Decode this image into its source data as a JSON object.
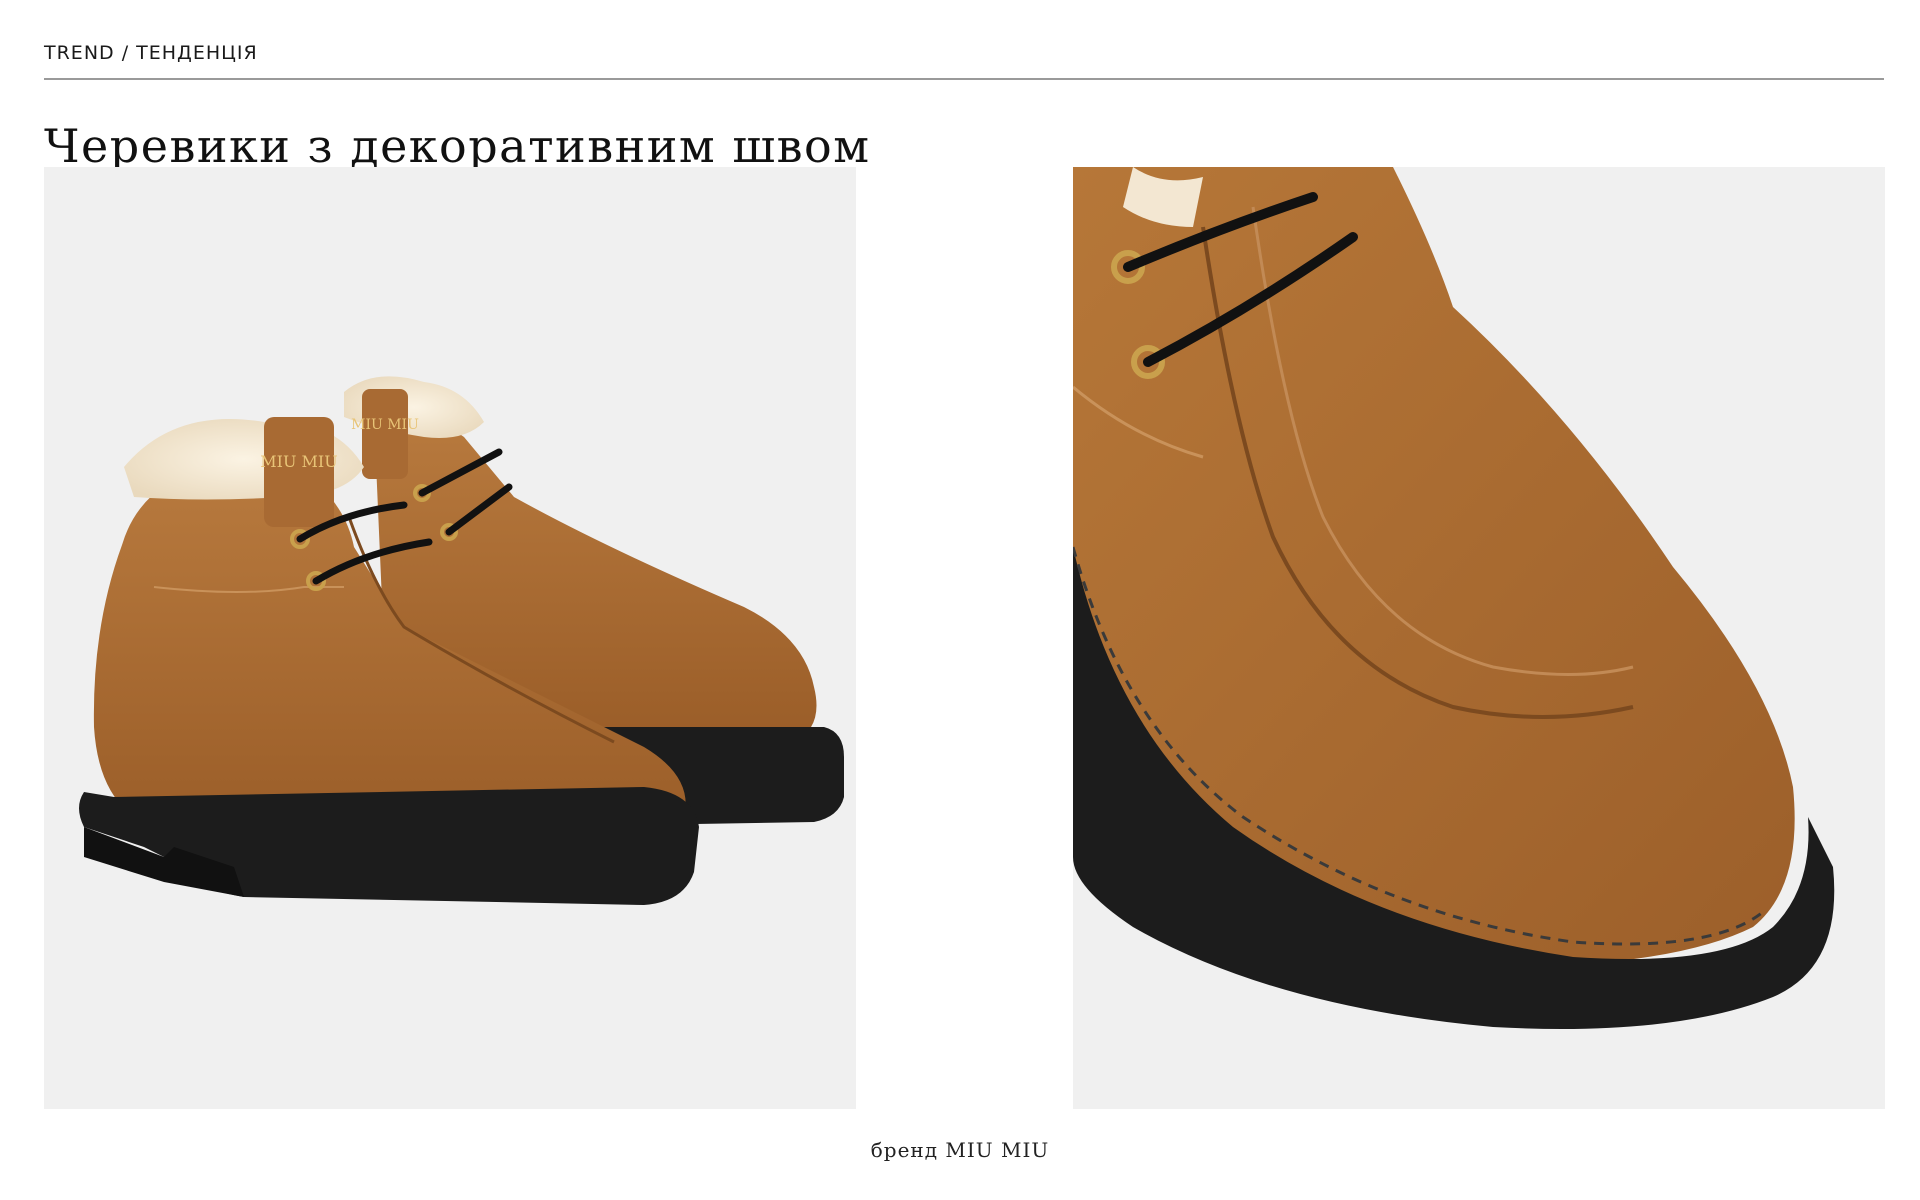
{
  "header": {
    "breadcrumb": "TREND / ТЕНДЕНЦІЯ",
    "title": "Черевики з декоративним швом"
  },
  "images": {
    "left": {
      "logo_text": "MIU MIU"
    },
    "right": {}
  },
  "footer": {
    "caption": "бренд MIU MIU"
  },
  "colors": {
    "suede": "#a86a33",
    "sole": "#1c1c1c",
    "shearling": "#f3e7d2",
    "background": "#f0f0f0",
    "rule": "#9a9a9a"
  }
}
